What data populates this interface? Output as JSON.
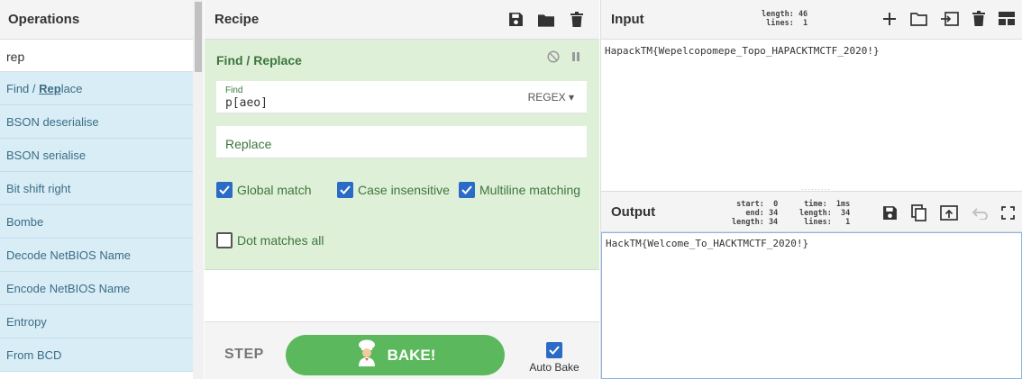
{
  "operations": {
    "title": "Operations",
    "search_value": "rep",
    "items": [
      {
        "pre": "Find / ",
        "hl": "Rep",
        "post": "lace"
      },
      {
        "pre": "BSON deserialise",
        "hl": "",
        "post": ""
      },
      {
        "pre": "BSON serialise",
        "hl": "",
        "post": ""
      },
      {
        "pre": "Bit shift right",
        "hl": "",
        "post": ""
      },
      {
        "pre": "Bombe",
        "hl": "",
        "post": ""
      },
      {
        "pre": "Decode NetBIOS Name",
        "hl": "",
        "post": ""
      },
      {
        "pre": "Encode NetBIOS Name",
        "hl": "",
        "post": ""
      },
      {
        "pre": "Entropy",
        "hl": "",
        "post": ""
      },
      {
        "pre": "From BCD",
        "hl": "",
        "post": ""
      }
    ]
  },
  "recipe": {
    "title": "Recipe",
    "op_title": "Find / Replace",
    "find_label": "Find",
    "find_value": "p[aeo]",
    "find_mode": "REGEX",
    "replace_placeholder": "Replace",
    "checkboxes": {
      "global": "Global match",
      "case": "Case insensitive",
      "multiline": "Multiline matching",
      "dotall": "Dot matches all"
    },
    "step_label": "STEP",
    "bake_label": "BAKE!",
    "auto_bake_label": "Auto Bake"
  },
  "input": {
    "title": "Input",
    "stats": "length: 46\n lines:  1",
    "text": "HapackTM{Wepelcopomepe_Topo_HAPACKTMCTF_2020!}"
  },
  "output": {
    "title": "Output",
    "stats_left": "start:  0\n  end: 34\nlength: 34",
    "stats_right": "time:  1ms\nlength:  34\n lines:   1",
    "text": "HackTM{Welcome_To_HACKTMCTF_2020!}"
  },
  "colors": {
    "accent_green": "#5cb85c",
    "op_card_bg": "#dff0d8",
    "op_list_bg": "#d9edf7",
    "checkbox_blue": "#2a6bc6"
  }
}
